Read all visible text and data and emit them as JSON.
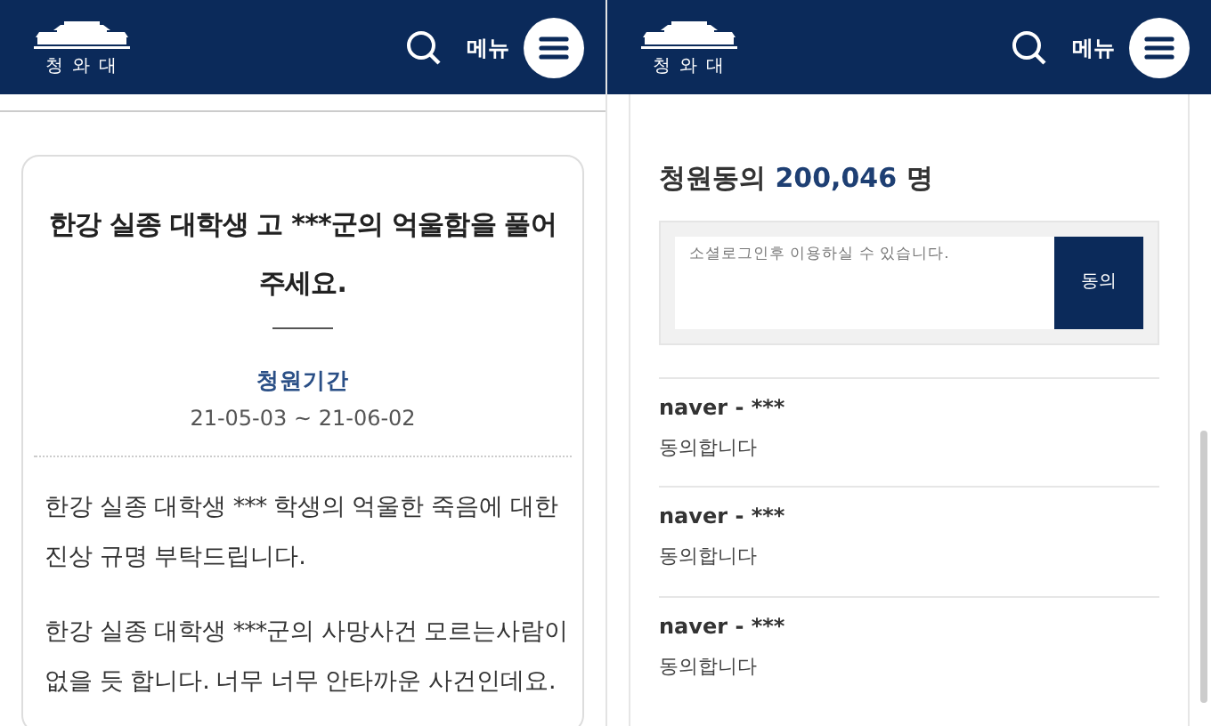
{
  "left_screen": {
    "header": {
      "logo_text": "청 와 대",
      "menu_label": "메뉴"
    },
    "petition": {
      "title": "한강 실종 대학생 고 ***군의 억울함을 풀어주세요.",
      "period_label": "청원기간",
      "period": "21-05-03 ~ 21-06-02",
      "paragraphs": [
        "한강 실종 대학생 *** 학생의 억울한 죽음에 대한 진상 규명 부탁드립니다.",
        "한강 실종 대학생 ***군의 사망사건 모르는사람이 없을 듯 합니다. 너무 너무 안타까운 사건인데요."
      ]
    }
  },
  "right_screen": {
    "header": {
      "logo_text": "청 와 대",
      "menu_label": "메뉴"
    },
    "agreement": {
      "label": "청원동의",
      "count": "200,046",
      "unit": "명",
      "placeholder": "소셜로그인후 이용하실 수 있습니다.",
      "button": "동의"
    },
    "comments": [
      {
        "author": "naver - ***",
        "text": "동의합니다"
      },
      {
        "author": "naver - ***",
        "text": "동의합니다"
      },
      {
        "author": "naver - ***",
        "text": "동의합니다"
      }
    ]
  }
}
